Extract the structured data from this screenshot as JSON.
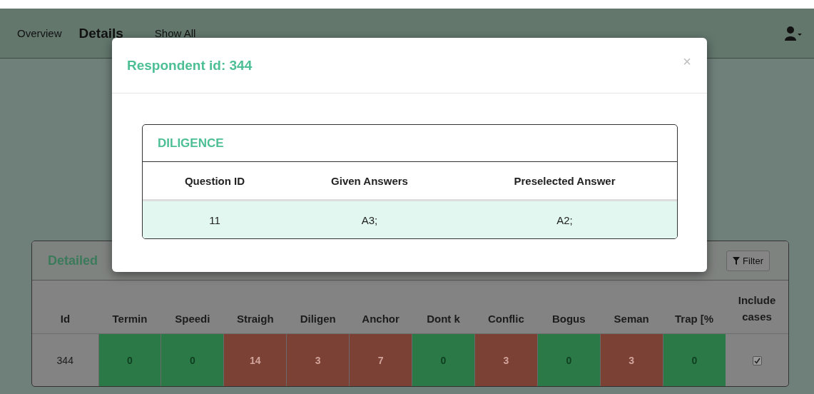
{
  "nav": {
    "tabs": [
      {
        "label": "Overview",
        "selected": false
      },
      {
        "label": "Details",
        "selected": true
      },
      {
        "label": "Show All",
        "selected": false
      }
    ]
  },
  "panel": {
    "title": "Detailed",
    "filter_button": "Filter",
    "columns": [
      "Id",
      "Termin",
      "Speedi",
      "Straigh",
      "Diligen",
      "Anchor",
      "Dont k",
      "Conflic",
      "Bogus",
      "Seman",
      "Trap [%",
      "Include cases"
    ],
    "rows": [
      {
        "cells": [
          {
            "value": "344"
          },
          {
            "value": "0",
            "color": "#2a7947"
          },
          {
            "value": "0",
            "color": "#2a7947"
          },
          {
            "value": "14",
            "color": "#7c4135"
          },
          {
            "value": "3",
            "color": "#7c4135"
          },
          {
            "value": "7",
            "color": "#7c4135"
          },
          {
            "value": "0",
            "color": "#2a7947"
          },
          {
            "value": "3",
            "color": "#7c4135"
          },
          {
            "value": "0",
            "color": "#2a7947"
          },
          {
            "value": "3",
            "color": "#7c4135"
          },
          {
            "value": "0",
            "color": "#2a7947"
          }
        ],
        "checked": true
      }
    ]
  },
  "modal": {
    "title": "Respondent id: 344",
    "close": "×",
    "section": "DILIGENCE",
    "columns": [
      "Question ID",
      "Given Answers",
      "Preselected Answer"
    ],
    "rows": [
      [
        "11",
        "A3;",
        "A2;"
      ]
    ]
  }
}
